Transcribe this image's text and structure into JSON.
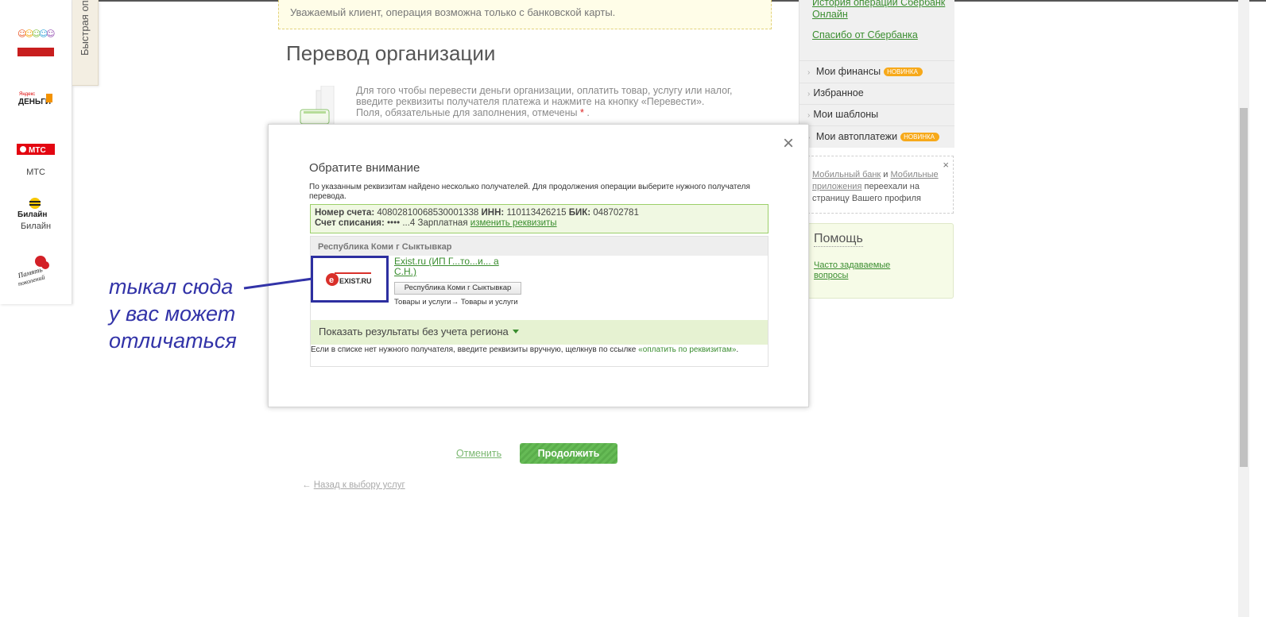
{
  "partners": [
    {
      "name": "Подари жизнь"
    },
    {
      "name": "Яндекс Деньги",
      "logo_text": "Яндекс\nДеньги"
    },
    {
      "name": "МТС",
      "logo_text": "МТС"
    },
    {
      "name": "Билайн",
      "logo_text": "Билайн"
    },
    {
      "name": "Память поколений",
      "logo_text": "Память поколений"
    }
  ],
  "quick_tab": "Быстрая оплата",
  "notice": "Уважаемый клиент, операция возможна только с банковской карты.",
  "page_title": "Перевод организации",
  "intro": {
    "line1": "Для того чтобы перевести деньги организации, оплатить товар, услугу или налог,",
    "line2": "введите реквизиты получателя платежа и нажмите на кнопку «Перевести».",
    "line3": "Поля, обязательные для заполнения, отмечены",
    "star": "*",
    "dot": "."
  },
  "right_col": {
    "history_link": "История операций Сбербанк Онлайн",
    "spasibo_link": "Спасибо от Сбербанка",
    "menu": [
      {
        "label": "Мои финансы",
        "badge": "НОВИНКА"
      },
      {
        "label": "Избранное",
        "badge": ""
      },
      {
        "label": "Мои шаблоны",
        "badge": ""
      },
      {
        "label": "Мои автоплатежи",
        "badge": "НОВИНКА"
      }
    ],
    "mobile_note": {
      "close": "×",
      "link1": "Мобильный банк",
      "and": "и",
      "link2": "Мобильные приложения",
      "rest": "переехали на страницу Вашего профиля"
    },
    "help": {
      "title": "Помощь",
      "faq": "Часто задаваемые вопросы"
    }
  },
  "modal": {
    "close": "×",
    "title": "Обратите внимание",
    "desc": "По указанным реквизитам найдено несколько получателей. Для продолжения операции выберите нужного получателя перевода.",
    "account_label": "Номер счета:",
    "account": "40802810068530001338",
    "inn_label": "ИНН:",
    "inn": "110113426215",
    "bik_label": "БИК:",
    "bik": "048702781",
    "debit_label": "Счет списания:",
    "debit_value": "•••• ...4",
    "debit_name": "Зарплатная",
    "change_link": "изменить реквизиты",
    "region_header": "Республика Коми г Сыктывкар",
    "recipient_name": "Exist.ru (ИП Г...то...и... а С.Н.)",
    "recipient_logo": "EXIST.RU",
    "recipient_region": "Республика Коми г Сыктывкар",
    "recipient_category": "Товары и услуги→ Товары и услуги",
    "show_all": "Показать результаты без учета региона",
    "manual_text": "Если в списке нет нужного получателя, введите реквизиты вручную, щелкнув по ссылке ",
    "manual_link": "«оплатить по реквизитам»",
    "manual_end": "."
  },
  "actions": {
    "cancel": "Отменить",
    "continue": "Продолжить",
    "back": "Назад к выбору услуг",
    "back_arrow": "←"
  },
  "annotation": {
    "line1": "тыкал сюда",
    "line2": "у вас может",
    "line3": "отличаться"
  },
  "colors": {
    "brand_green": "#3a8d2f",
    "annotation_blue": "#3233a8",
    "badge_orange": "#f7a91a"
  }
}
